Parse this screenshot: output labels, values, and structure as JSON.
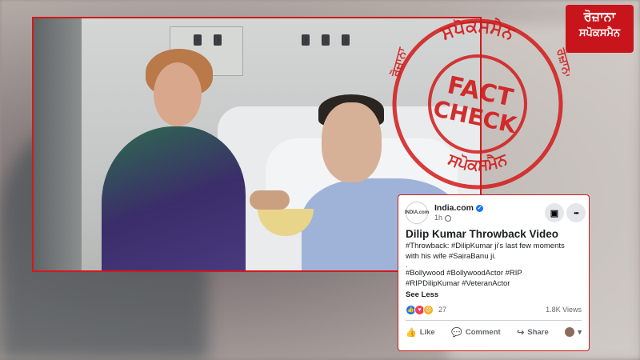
{
  "brand": {
    "logo_line1": "ਰੋਜ਼ਾਨਾ",
    "logo_line2": "ਸਪੋਕਸਮੈਨ",
    "accent": "#d11a1a"
  },
  "stamp": {
    "main_line1": "FACT",
    "main_line2": "CHECK",
    "ring_top": "ਸਪੋਕਸਮੈਨ",
    "ring_left": "ਰੋਜ਼ਾਨਾ",
    "ring_right": "ਰੋਜ਼ਾਨਾ",
    "ring_bottom": "ਸਪੋਕਸਮੈਨ",
    "color": "#d11a1a"
  },
  "post": {
    "avatar_text": "INDIA.com",
    "page_name": "India.com",
    "time": "1h",
    "title": "Dilip Kumar Throwback Video",
    "text_line1": "#Throwback: #DilipKumar ji's last few moments",
    "text_line2": "with his wife #SairaBanu ji.",
    "dot": ".",
    "hashtags_line1": "#Bollywood #BollywoodActor #RIP",
    "hashtags_line2": "#RIPDilipKumar #VeteranActor",
    "see_less": "See Less",
    "reaction_count": "27",
    "views": "1.8K Views",
    "actions": {
      "like": "Like",
      "comment": "Comment",
      "share": "Share"
    },
    "more_icon": "•••"
  }
}
